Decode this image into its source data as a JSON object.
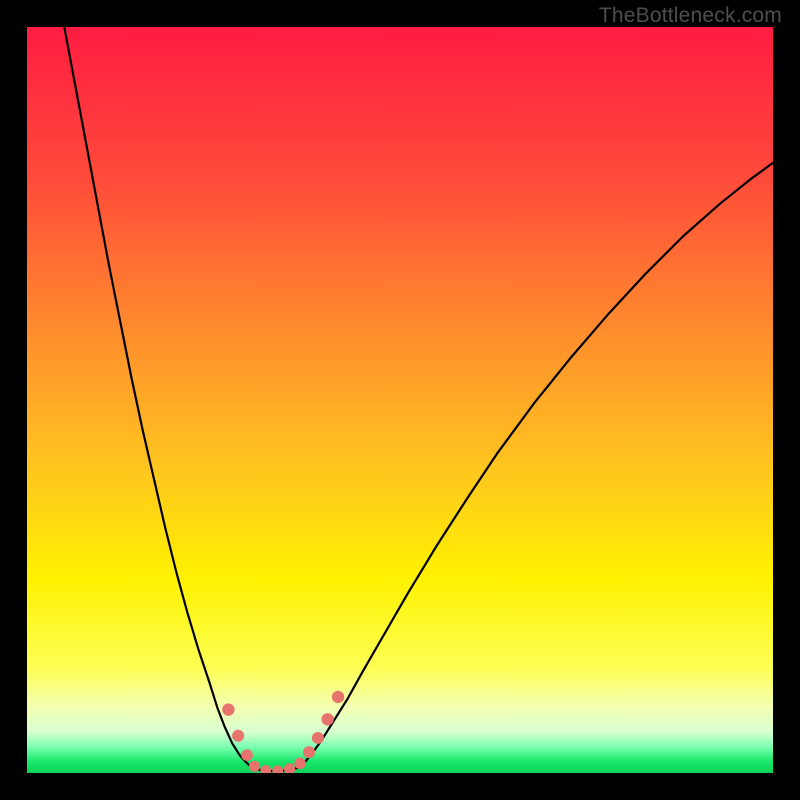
{
  "watermark": "TheBottleneck.com",
  "chart_data": {
    "type": "line",
    "title": "",
    "xlabel": "",
    "ylabel": "",
    "xlim": [
      0,
      100
    ],
    "ylim": [
      0,
      100
    ],
    "gradient_stops": [
      {
        "offset": 0.0,
        "color": "#ff1c42"
      },
      {
        "offset": 0.2,
        "color": "#ff4a3a"
      },
      {
        "offset": 0.4,
        "color": "#ff8a2e"
      },
      {
        "offset": 0.58,
        "color": "#ffc220"
      },
      {
        "offset": 0.74,
        "color": "#fff200"
      },
      {
        "offset": 0.86,
        "color": "#fdff55"
      },
      {
        "offset": 0.91,
        "color": "#f4ffb0"
      },
      {
        "offset": 0.945,
        "color": "#d8ffd0"
      },
      {
        "offset": 0.965,
        "color": "#7bffb0"
      },
      {
        "offset": 0.985,
        "color": "#17e86a"
      },
      {
        "offset": 1.0,
        "color": "#0fd158"
      }
    ],
    "series": [
      {
        "name": "left-curve",
        "stroke": "#000000",
        "stroke_width": 2.2,
        "points": [
          [
            5.0,
            100.0
          ],
          [
            6.5,
            92.0
          ],
          [
            8.0,
            84.0
          ],
          [
            9.5,
            76.0
          ],
          [
            11.0,
            68.0
          ],
          [
            12.5,
            60.5
          ],
          [
            14.0,
            53.0
          ],
          [
            15.5,
            46.0
          ],
          [
            17.0,
            39.5
          ],
          [
            18.5,
            33.0
          ],
          [
            20.0,
            27.0
          ],
          [
            21.5,
            21.5
          ],
          [
            23.0,
            16.5
          ],
          [
            24.5,
            12.0
          ],
          [
            25.5,
            8.8
          ],
          [
            26.5,
            6.2
          ],
          [
            27.5,
            4.0
          ],
          [
            28.5,
            2.4
          ],
          [
            29.5,
            1.3
          ],
          [
            30.2,
            0.7
          ]
        ]
      },
      {
        "name": "right-curve",
        "stroke": "#000000",
        "stroke_width": 2.2,
        "points": [
          [
            36.3,
            0.7
          ],
          [
            37.2,
            1.4
          ],
          [
            38.2,
            2.6
          ],
          [
            39.5,
            4.4
          ],
          [
            41.0,
            6.8
          ],
          [
            43.0,
            10.0
          ],
          [
            45.0,
            13.6
          ],
          [
            48.0,
            18.8
          ],
          [
            51.0,
            24.0
          ],
          [
            55.0,
            30.6
          ],
          [
            59.0,
            36.8
          ],
          [
            63.0,
            42.8
          ],
          [
            68.0,
            49.6
          ],
          [
            73.0,
            55.8
          ],
          [
            78.0,
            61.6
          ],
          [
            83.0,
            67.0
          ],
          [
            88.0,
            72.0
          ],
          [
            93.0,
            76.4
          ],
          [
            97.0,
            79.6
          ],
          [
            100.0,
            81.8
          ]
        ]
      },
      {
        "name": "bottom-curve",
        "stroke": "#000000",
        "stroke_width": 2.2,
        "points": [
          [
            30.2,
            0.7
          ],
          [
            31.0,
            0.45
          ],
          [
            32.0,
            0.3
          ],
          [
            33.0,
            0.25
          ],
          [
            34.0,
            0.28
          ],
          [
            35.0,
            0.38
          ],
          [
            36.3,
            0.7
          ]
        ]
      }
    ],
    "markers": [
      {
        "x": 27.0,
        "y": 8.5,
        "r": 6.2,
        "fill": "#e6746d"
      },
      {
        "x": 28.3,
        "y": 5.0,
        "r": 6.0,
        "fill": "#e6746d"
      },
      {
        "x": 29.5,
        "y": 2.4,
        "r": 5.8,
        "fill": "#e6746d"
      },
      {
        "x": 30.5,
        "y": 0.9,
        "r": 5.6,
        "fill": "#e6746d"
      },
      {
        "x": 32.0,
        "y": 0.35,
        "r": 5.4,
        "fill": "#e6746d"
      },
      {
        "x": 33.6,
        "y": 0.3,
        "r": 5.4,
        "fill": "#e6746d"
      },
      {
        "x": 35.2,
        "y": 0.55,
        "r": 5.6,
        "fill": "#e6746d"
      },
      {
        "x": 36.6,
        "y": 1.3,
        "r": 5.8,
        "fill": "#e6746d"
      },
      {
        "x": 37.8,
        "y": 2.8,
        "r": 6.0,
        "fill": "#e6746d"
      },
      {
        "x": 39.0,
        "y": 4.7,
        "r": 6.0,
        "fill": "#e6746d"
      },
      {
        "x": 40.3,
        "y": 7.2,
        "r": 6.2,
        "fill": "#e6746d"
      },
      {
        "x": 41.7,
        "y": 10.2,
        "r": 6.2,
        "fill": "#e6746d"
      }
    ]
  }
}
